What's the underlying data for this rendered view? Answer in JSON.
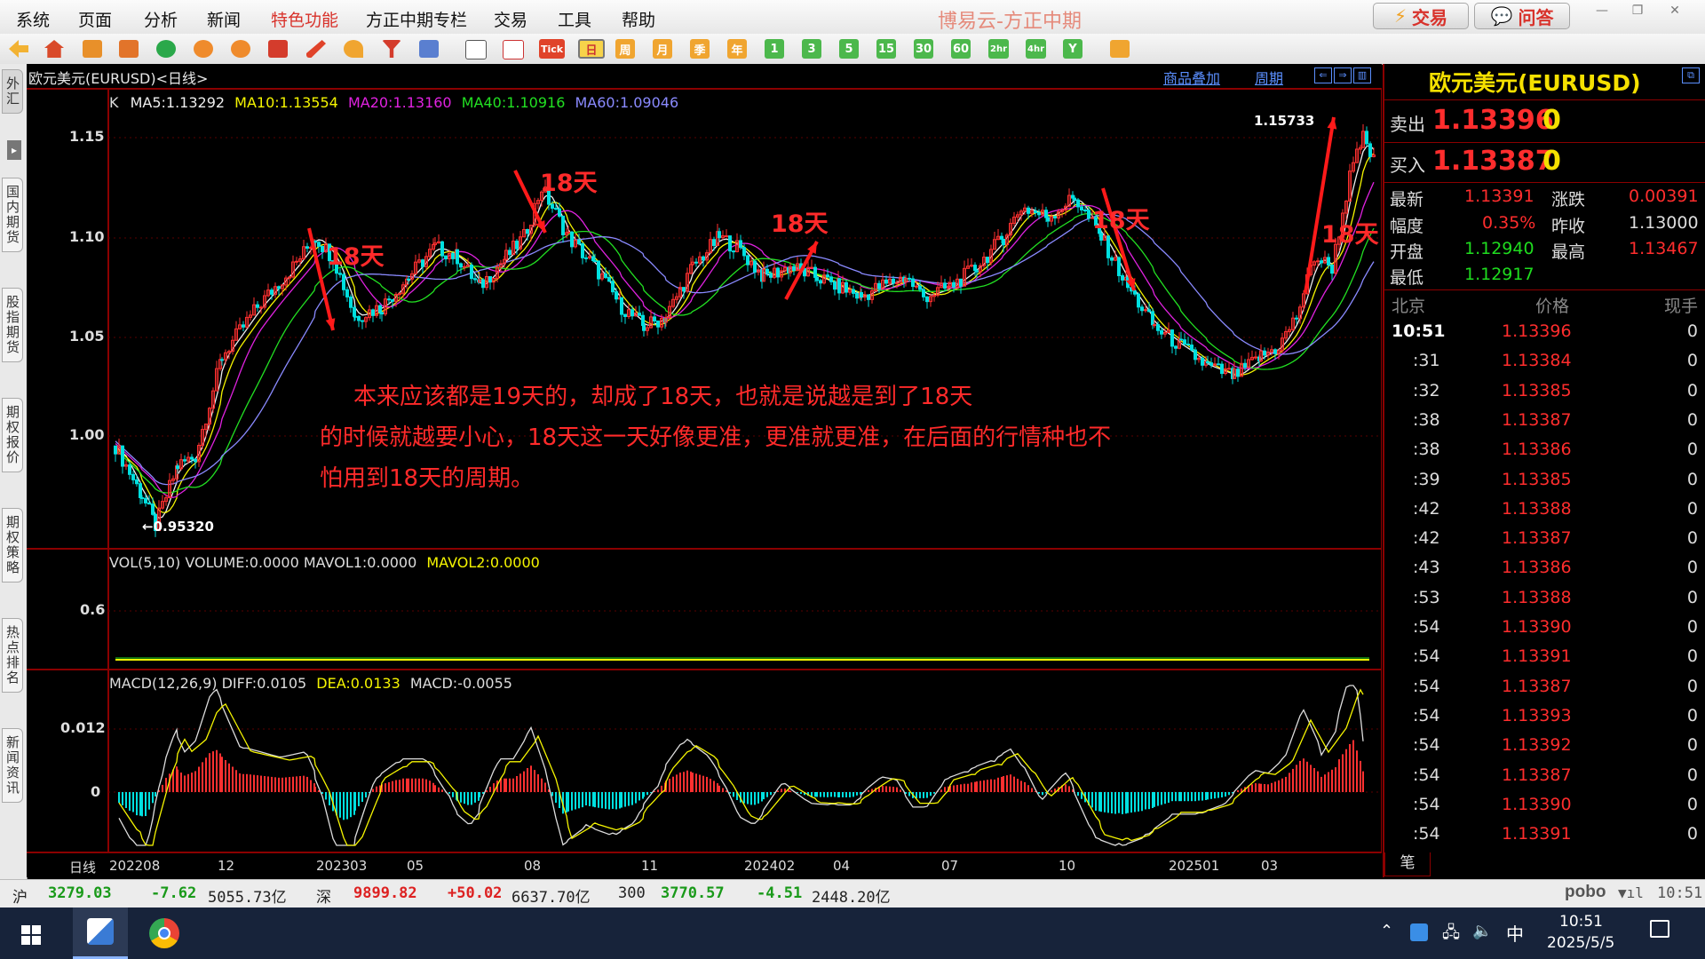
{
  "menubar": {
    "items": [
      "系统",
      "页面",
      "分析",
      "新闻",
      "特色功能",
      "方正中期专栏",
      "交易",
      "工具",
      "帮助"
    ],
    "app_title": "博易云-方正中期",
    "trade_button": "交易",
    "ask_button": "问答"
  },
  "toolbar": {
    "period_buttons": [
      "Tick",
      "日",
      "周",
      "月",
      "季",
      "年",
      "1",
      "3",
      "5",
      "15",
      "30",
      "60",
      "2hr",
      "4hr",
      "Y"
    ]
  },
  "left_tabs": [
    "外汇",
    "国内期货",
    "股指期货",
    "期权报价",
    "期权策略",
    "热点排名",
    "新闻资讯"
  ],
  "chart_header": {
    "instrument": "欧元美元(EURUSD)<日线>",
    "overlay_link": "商品叠加",
    "cycle_link": "周期"
  },
  "main_chart": {
    "ma_legend": [
      {
        "text": "K",
        "color": "#dddddd"
      },
      {
        "text": "MA5:1.13292",
        "color": "#eeeeee"
      },
      {
        "text": "MA10:1.13554",
        "color": "#f5f500"
      },
      {
        "text": "MA20:1.13160",
        "color": "#e022e0"
      },
      {
        "text": "MA40:1.10916",
        "color": "#22e022"
      },
      {
        "text": "MA60:1.09046",
        "color": "#8a8aff"
      }
    ],
    "y_ticks": [
      "1.15",
      "1.10",
      "1.05",
      "1.00"
    ],
    "high_label": "1.15733",
    "low_label": "0.95320",
    "cycle_labels": [
      "18天",
      "18天",
      "18天",
      "18天",
      "18天"
    ],
    "annotation_lines": [
      "本来应该都是19天的，却成了18天，也就是说越是到了18天",
      "的时候就越要小心，18天这一天好像更准，更准就更准，在后面的行情种也不",
      "怕用到18天的周期。"
    ]
  },
  "chart_data": {
    "type": "line",
    "ma_series": [
      "MA5",
      "MA10",
      "MA20",
      "MA40",
      "MA60"
    ],
    "y_range_main": [
      0.95,
      1.17
    ],
    "key_points": [
      {
        "label": "low",
        "value": 0.9532
      },
      {
        "label": "high",
        "value": 1.15733
      }
    ],
    "volume_title": "VOL(5,10) VOLUME:0.0000 MAVOL1:0.0000 MAVOL2:0.0000",
    "macd_title": "MACD(12,26,9) DIFF:0.0105 DEA:0.0133 MACD:-0.0055"
  },
  "volume_panel": {
    "legend": [
      {
        "text": "VOL(5,10) VOLUME:0.0000 MAVOL1:0.0000",
        "color": "#dddddd"
      },
      {
        "text": "MAVOL2:0.0000",
        "color": "#f5f500"
      }
    ],
    "y_tick": "0.6"
  },
  "macd_panel": {
    "legend": [
      {
        "text": "MACD(12,26,9) DIFF:0.0105",
        "color": "#dddddd"
      },
      {
        "text": "DEA:0.0133",
        "color": "#f5f500"
      },
      {
        "text": "MACD:-0.0055",
        "color": "#dddddd"
      }
    ],
    "y_ticks": [
      "0.012",
      "0"
    ]
  },
  "x_axis": {
    "label": "日线",
    "ticks": [
      "202208",
      "12",
      "202303",
      "05",
      "08",
      "11",
      "202402",
      "04",
      "07",
      "10",
      "202501",
      "03"
    ]
  },
  "quote_panel": {
    "title": "欧元美元(EURUSD)",
    "sell_label": "卖出",
    "sell_price": "1.13396",
    "sell_qty": "0",
    "buy_label": "买入",
    "buy_price": "1.13387",
    "buy_qty": "0",
    "stats": [
      {
        "label": "最新",
        "value": "1.13391",
        "label2": "涨跌",
        "value2": "0.00391"
      },
      {
        "label": "幅度",
        "value": "0.35%",
        "label2": "昨收",
        "value2": "1.13000"
      },
      {
        "label": "开盘",
        "value": "1.12940",
        "label2": "最高",
        "value2": "1.13467"
      },
      {
        "label": "最低",
        "value": "1.12917",
        "label2": "",
        "value2": ""
      }
    ],
    "tick_header": {
      "time": "北京",
      "price": "价格",
      "vol": "现手"
    },
    "ticks": [
      {
        "t": "10:51",
        "p": "1.13396",
        "v": "0"
      },
      {
        "t": ":31",
        "p": "1.13384",
        "v": "0"
      },
      {
        "t": ":32",
        "p": "1.13385",
        "v": "0"
      },
      {
        "t": ":38",
        "p": "1.13387",
        "v": "0"
      },
      {
        "t": ":38",
        "p": "1.13386",
        "v": "0"
      },
      {
        "t": ":39",
        "p": "1.13385",
        "v": "0"
      },
      {
        "t": ":42",
        "p": "1.13388",
        "v": "0"
      },
      {
        "t": ":42",
        "p": "1.13387",
        "v": "0"
      },
      {
        "t": ":43",
        "p": "1.13386",
        "v": "0"
      },
      {
        "t": ":53",
        "p": "1.13388",
        "v": "0"
      },
      {
        "t": ":54",
        "p": "1.13390",
        "v": "0"
      },
      {
        "t": ":54",
        "p": "1.13391",
        "v": "0"
      },
      {
        "t": ":54",
        "p": "1.13387",
        "v": "0"
      },
      {
        "t": ":54",
        "p": "1.13393",
        "v": "0"
      },
      {
        "t": ":54",
        "p": "1.13392",
        "v": "0"
      },
      {
        "t": ":54",
        "p": "1.13387",
        "v": "0"
      },
      {
        "t": ":54",
        "p": "1.13390",
        "v": "0"
      },
      {
        "t": ":54",
        "p": "1.13391",
        "v": "0"
      }
    ],
    "bottom_tab": "笔"
  },
  "statusbar": {
    "sh_label": "沪",
    "sh_index": "3279.03",
    "sh_change": "-7.62",
    "sh_amount": "5055.73亿",
    "sz_label": "深",
    "sz_index": "9899.82",
    "sz_change": "+50.02",
    "sz_amount": "6637.70亿",
    "hs_label": "300",
    "hs_index": "3770.57",
    "hs_change": "-4.51",
    "hs_amount": "2448.20亿",
    "brand": "pobo",
    "time": "10:51"
  },
  "taskbar": {
    "ime": "中",
    "clock_time": "10:51",
    "clock_date": "2025/5/5"
  }
}
